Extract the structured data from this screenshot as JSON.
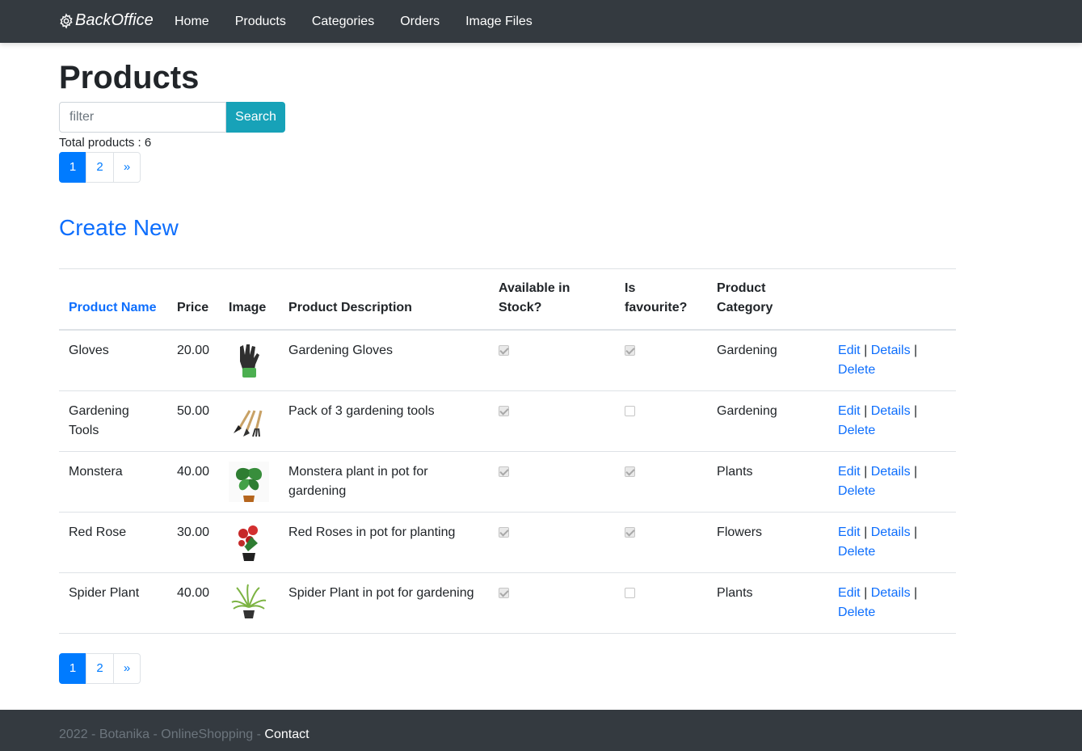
{
  "navbar": {
    "brand": "BackOffice",
    "links": [
      "Home",
      "Products",
      "Categories",
      "Orders",
      "Image Files"
    ]
  },
  "page": {
    "title": "Products",
    "filter_placeholder": "filter",
    "search_label": "Search",
    "total_text": "Total products : 6",
    "create_new": "Create New"
  },
  "pagination": {
    "pages": [
      "1",
      "2"
    ],
    "next": "»",
    "active": "1"
  },
  "table": {
    "headers": {
      "name": "Product Name",
      "price": "Price",
      "image": "Image",
      "description": "Product Description",
      "stock": "Available in Stock?",
      "favourite": "Is favourite?",
      "category": "Product Category"
    },
    "rows": [
      {
        "name": "Gloves",
        "price": "20.00",
        "image": "gloves",
        "description": "Gardening Gloves",
        "stock": true,
        "favourite": true,
        "category": "Gardening"
      },
      {
        "name": "Gardening Tools",
        "price": "50.00",
        "image": "gardening-tools",
        "description": "Pack of 3 gardening tools",
        "stock": true,
        "favourite": false,
        "category": "Gardening"
      },
      {
        "name": "Monstera",
        "price": "40.00",
        "image": "monstera",
        "description": "Monstera plant in pot for gardening",
        "stock": true,
        "favourite": true,
        "category": "Plants"
      },
      {
        "name": "Red Rose",
        "price": "30.00",
        "image": "red-rose",
        "description": "Red Roses in pot for planting",
        "stock": true,
        "favourite": true,
        "category": "Flowers"
      },
      {
        "name": "Spider Plant",
        "price": "40.00",
        "image": "spider-plant",
        "description": "Spider Plant in pot for gardening",
        "stock": true,
        "favourite": false,
        "category": "Plants"
      }
    ],
    "actions": {
      "edit": "Edit",
      "details": "Details",
      "delete": "Delete",
      "separator": "|"
    }
  },
  "footer": {
    "text": "2022 - Botanika - OnlineShopping - ",
    "contact": "Contact"
  },
  "colors": {
    "navbar": "#343a40",
    "primary": "#007bff",
    "link": "#0d6efd",
    "search": "#17a2b8"
  }
}
